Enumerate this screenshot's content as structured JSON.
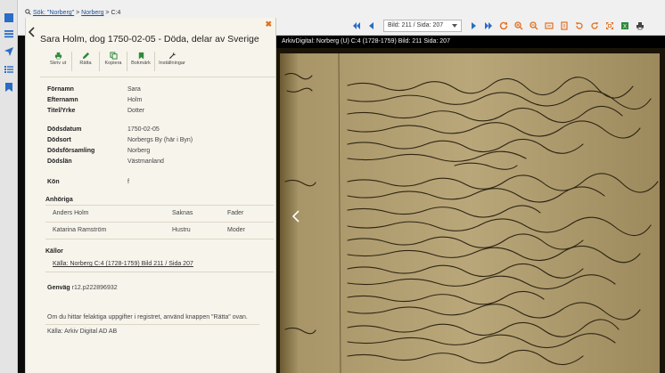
{
  "breadcrumb": {
    "search_label": "Sök: \"Norberg\"",
    "sep1": ">",
    "parish_link": "Norberg",
    "sep2": ">",
    "volume": "C:4"
  },
  "toolbar": {
    "page_value": "Bild: 211 / Sida: 207"
  },
  "viewer": {
    "title": "ArkivDigital: Norberg (U) C:4 (1728-1759) Bild: 211 Sida: 207"
  },
  "panel": {
    "title": "Sara Holm, dog 1750-02-05 - Döda, delar av Sverige",
    "actions": {
      "print": "Skriv ut",
      "correct": "Rätta",
      "copy": "Kopiera",
      "bookmark": "Bokmärk",
      "settings": "Inställningar"
    },
    "fields": {
      "fornamn_label": "Förnamn",
      "fornamn": "Sara",
      "efternamn_label": "Efternamn",
      "efternamn": "Holm",
      "titel_label": "Titel/Yrke",
      "titel": "Dotter",
      "dodsdatum_label": "Dödsdatum",
      "dodsdatum": "1750-02-05",
      "dodsort_label": "Dödsort",
      "dodsort": "Norbergs By (här i Byn)",
      "dodsforsamling_label": "Dödsförsamling",
      "dodsforsamling": "Norberg",
      "dodslan_label": "Dödslän",
      "dodslan": "Västmanland",
      "kon_label": "Kön",
      "kon": "f"
    },
    "relatives_header": "Anhöriga",
    "relatives": [
      {
        "name": "Anders Holm",
        "status": "Saknas",
        "relation": "Fader"
      },
      {
        "name": "Katarina Ramström",
        "status": "Hustru",
        "relation": "Moder"
      }
    ],
    "sources_header": "Källor",
    "source_link": "Källa: Norberg C:4 (1728-1759) Bild 211 / Sida 207",
    "shortcut_label": "Genväg",
    "shortcut_value": "r12.p222896932",
    "info_note": "Om du hittar felaktiga uppgifter i registret, använd knappen \"Rätta\" ovan.",
    "source_credit": "Källa: Arkiv Digital AD AB"
  }
}
